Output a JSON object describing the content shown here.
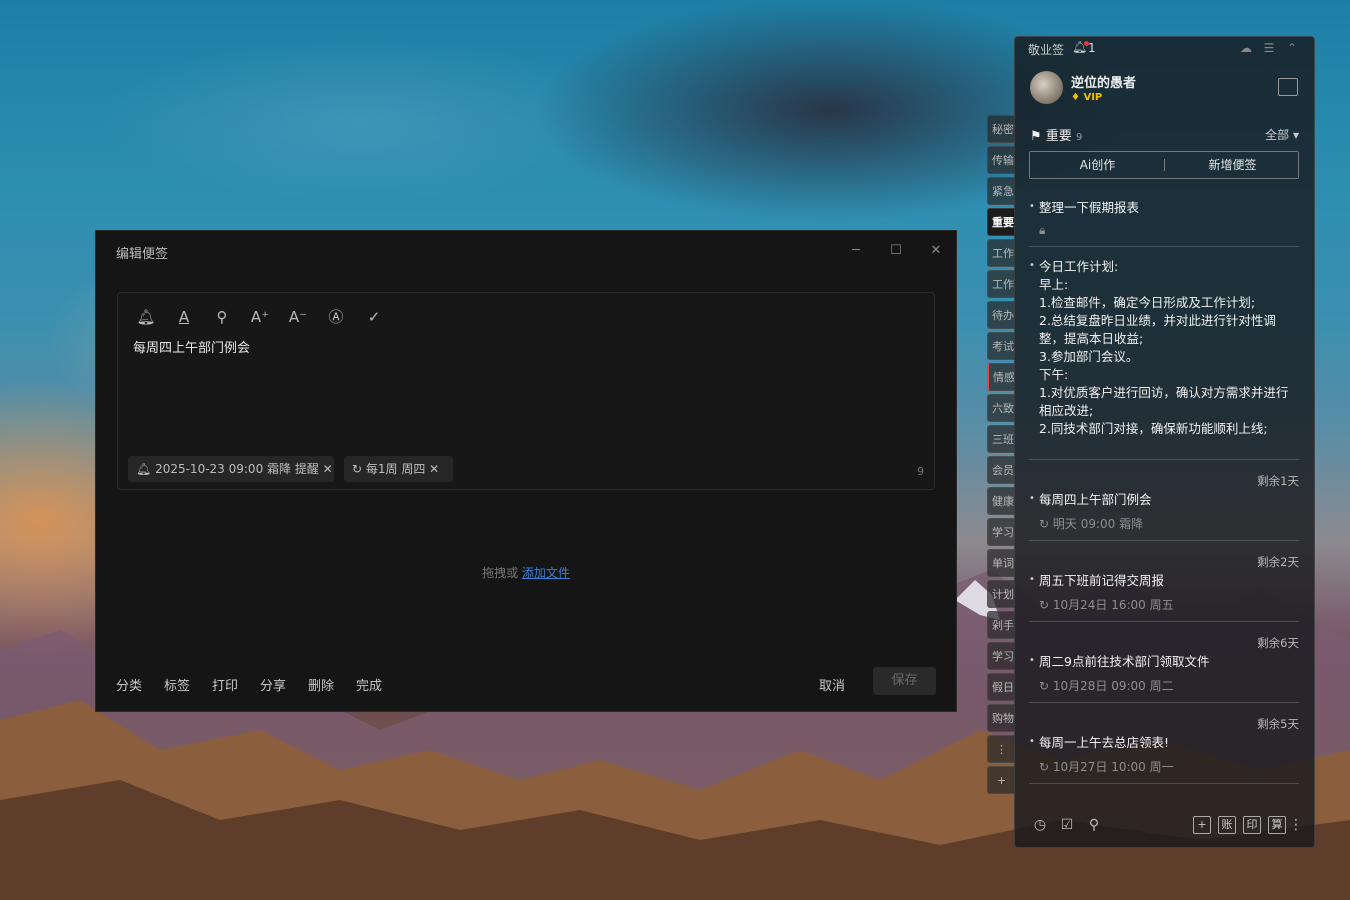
{
  "dialog": {
    "title": "编辑便签",
    "content": "每周四上午部门例会",
    "reminder_chip": "2025-10-23 09:00 霜降 提醒",
    "repeat_chip": "每1周 周四",
    "char_count": "9",
    "drop_text": "拖拽或",
    "drop_link": "添加文件",
    "actions": [
      "分类",
      "标签",
      "打印",
      "分享",
      "删除",
      "完成"
    ],
    "cancel": "取消",
    "save": "保存"
  },
  "side_tabs": [
    "秘密",
    "传输",
    "紧急",
    "重要",
    "工作",
    "工作",
    "待办",
    "考试",
    "情感",
    "六致",
    "三班",
    "会员",
    "健康",
    "学习",
    "单词",
    "计划",
    "剁手",
    "学习",
    "假日",
    "购物"
  ],
  "panel": {
    "app_name": "敬业签",
    "bell_count": "1",
    "user_name": "逆位的愚者",
    "vip": "VIP",
    "section_title": "重要",
    "section_count": "9",
    "filter": "全部",
    "ai_button": "Ai创作",
    "new_button": "新增便签",
    "notes": [
      {
        "title": "整理一下假期报表"
      },
      {
        "title": "今日工作计划:",
        "body": "早上:\n1.检查邮件，确定今日形成及工作计划;\n2.总结复盘昨日业绩，并对此进行针对性调整，提高本日收益;\n3.参加部门会议。\n下午:\n1.对优质客户进行回访，确认对方需求并进行相应改进;\n2.同技术部门对接，确保新功能顺利上线;"
      },
      {
        "left": "剩余1天",
        "title": "每周四上午部门例会",
        "meta": "明天 09:00 霜降"
      },
      {
        "left": "剩余2天",
        "title": "周五下班前记得交周报",
        "meta": "10月24日 16:00 周五"
      },
      {
        "left": "剩余6天",
        "title": "周二9点前往技术部门领取文件",
        "meta": "10月28日 09:00 周二"
      },
      {
        "left": "剩余5天",
        "title": "每周一上午去总店领表!",
        "meta": "10月27日 10:00 周一"
      }
    ],
    "bottom_boxes": [
      "+",
      "账",
      "印",
      "算"
    ]
  }
}
